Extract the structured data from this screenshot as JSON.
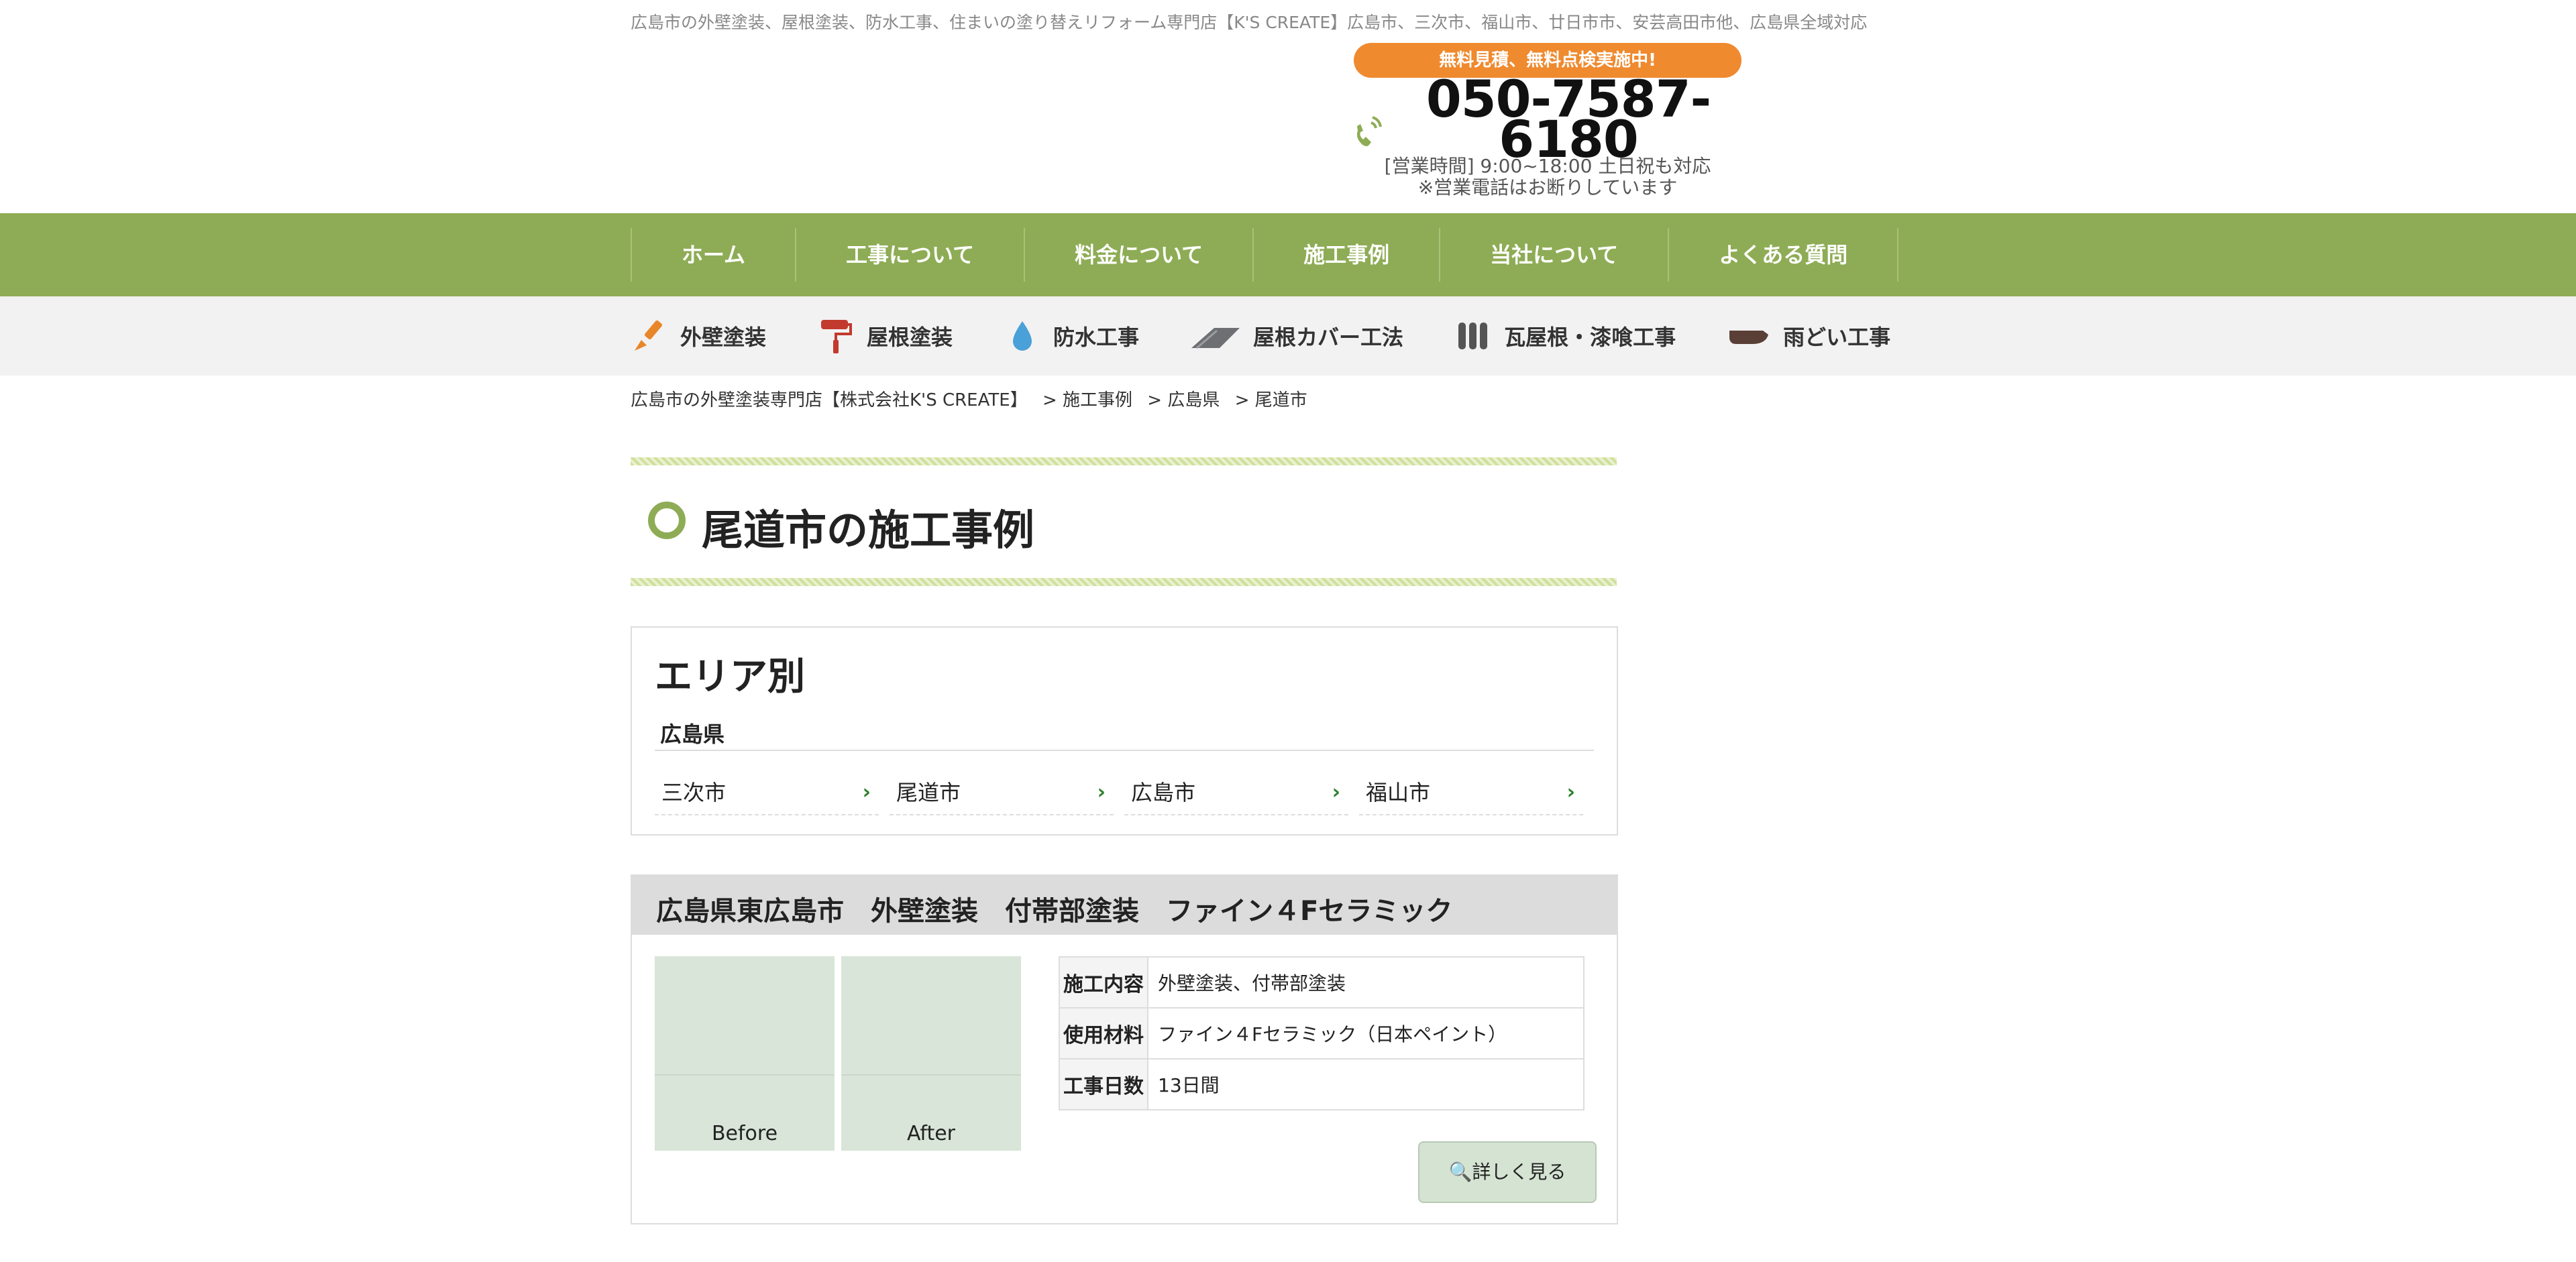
{
  "header": {
    "tagline": "広島市の外壁塗装、屋根塗装、防水工事、住まいの塗り替えリフォーム専門店【K'S CREATE】広島市、三次市、福山市、廿日市市、安芸高田市他、広島県全域対応",
    "estimate_badge": "無料見積、無料点検実施中!",
    "phone": "050-7587-6180",
    "hours_line1": "[営業時間] 9:00~18:00 土日祝も対応",
    "hours_line2": "※営業電話はお断りしています"
  },
  "nav": {
    "items": [
      {
        "label": "ホーム"
      },
      {
        "label": "工事について"
      },
      {
        "label": "料金について"
      },
      {
        "label": "施工事例"
      },
      {
        "label": "当社について"
      },
      {
        "label": "よくある質問"
      }
    ]
  },
  "subnav": {
    "items": [
      {
        "label": "外壁塗装",
        "icon": "paintbrush-icon"
      },
      {
        "label": "屋根塗装",
        "icon": "paint-roller-icon"
      },
      {
        "label": "防水工事",
        "icon": "water-drop-icon"
      },
      {
        "label": "屋根カバー工法",
        "icon": "roof-icon"
      },
      {
        "label": "瓦屋根・漆喰工事",
        "icon": "roof-tile-icon"
      },
      {
        "label": "雨どい工事",
        "icon": "rain-gutter-icon"
      }
    ]
  },
  "breadcrumb": [
    "広島市の外壁塗装専門店【株式会社K'S CREATE】",
    "> 施工事例",
    "> 広島県",
    "> 尾道市"
  ],
  "page_title": "尾道市の施工事例",
  "area": {
    "title": "エリア別",
    "prefecture": "広島県",
    "links": [
      "三次市",
      "尾道市",
      "広島市",
      "福山市"
    ]
  },
  "case": {
    "title": "広島県東広島市　外壁塗装　付帯部塗装　ファイン４Fセラミック",
    "before_label": "Before",
    "after_label": "After",
    "specs": [
      {
        "label": "施工内容",
        "value": "外壁塗装、付帯部塗装"
      },
      {
        "label": "使用材料",
        "value": "ファイン４Fセラミック（日本ペイント）"
      },
      {
        "label": "工事日数",
        "value": "13日間"
      }
    ],
    "more_button": "詳しく見る"
  },
  "colors": {
    "nav_green": "#8eac55",
    "badge_orange": "#ef8a2f",
    "link_chevron": "#2a7f2a"
  }
}
